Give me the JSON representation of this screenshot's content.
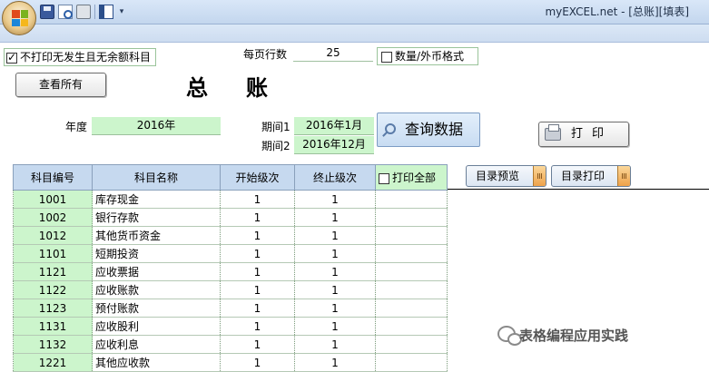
{
  "window": {
    "title": "myEXCEL.net - [总账][填表]"
  },
  "toolbar": {
    "icons": [
      "save-icon",
      "print-preview-icon",
      "print-icon",
      "split-view-icon",
      "customize-qat-icon"
    ]
  },
  "options": {
    "no_print_label": "不打印无发生且无余额科目",
    "no_print_checked": true,
    "rows_per_page_label": "每页行数",
    "rows_per_page_value": "25",
    "qty_format_label": "数量/外币格式",
    "qty_format_checked": false
  },
  "header": {
    "title": "总账",
    "view_all_label": "查看所有"
  },
  "filters": {
    "year_label": "年度",
    "year_value": "2016年",
    "period1_label": "期间1",
    "period1_value": "2016年1月",
    "period2_label": "期间2",
    "period2_value": "2016年12月",
    "query_label": "查询数据",
    "print_label": "打印"
  },
  "catalog": {
    "preview_label": "目录预览",
    "print_label": "目录打印"
  },
  "table": {
    "columns": [
      "科目编号",
      "科目名称",
      "开始级次",
      "终止级次"
    ],
    "print_all_label": "打印全部",
    "rows": [
      {
        "code": "1001",
        "name": "库存现金",
        "start": "1",
        "end": "1"
      },
      {
        "code": "1002",
        "name": "银行存款",
        "start": "1",
        "end": "1"
      },
      {
        "code": "1012",
        "name": "其他货币资金",
        "start": "1",
        "end": "1"
      },
      {
        "code": "1101",
        "name": "短期投资",
        "start": "1",
        "end": "1"
      },
      {
        "code": "1121",
        "name": "应收票据",
        "start": "1",
        "end": "1"
      },
      {
        "code": "1122",
        "name": "应收账款",
        "start": "1",
        "end": "1"
      },
      {
        "code": "1123",
        "name": "预付账款",
        "start": "1",
        "end": "1"
      },
      {
        "code": "1131",
        "name": "应收股利",
        "start": "1",
        "end": "1"
      },
      {
        "code": "1132",
        "name": "应收利息",
        "start": "1",
        "end": "1"
      },
      {
        "code": "1221",
        "name": "其他应收款",
        "start": "1",
        "end": "1"
      }
    ]
  },
  "watermark": {
    "text": "表格编程应用实践"
  }
}
